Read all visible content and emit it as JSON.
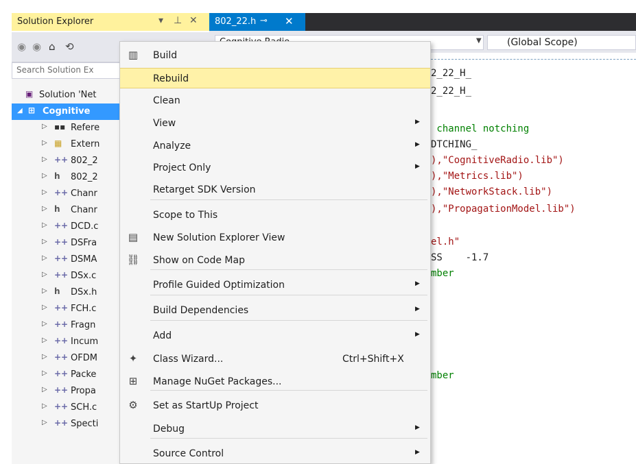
{
  "solution_explorer": {
    "title": "Solution Explorer",
    "controls": {
      "dropdown": "▾",
      "pin": "⊥",
      "close": "✕"
    },
    "search_placeholder": "Search Solution Ex",
    "solution_label": "Solution 'Net",
    "project_label": "Cognitive",
    "items": [
      {
        "label": "Refere",
        "icon": "references-icon",
        "glyph": "▪▪"
      },
      {
        "label": "Extern",
        "icon": "folder-icon",
        "glyph": "▦"
      },
      {
        "label": "802_2",
        "icon": "c-file-icon",
        "glyph": "++"
      },
      {
        "label": "802_2",
        "icon": "h-file-icon",
        "glyph": "h"
      },
      {
        "label": "Chanr",
        "icon": "c-file-icon",
        "glyph": "++"
      },
      {
        "label": "Chanr",
        "icon": "h-file-icon",
        "glyph": "h"
      },
      {
        "label": "DCD.c",
        "icon": "c-file-icon",
        "glyph": "++"
      },
      {
        "label": "DSFra",
        "icon": "c-file-icon",
        "glyph": "++"
      },
      {
        "label": "DSMA",
        "icon": "c-file-icon",
        "glyph": "++"
      },
      {
        "label": "DSx.c",
        "icon": "c-file-icon",
        "glyph": "++"
      },
      {
        "label": "DSx.h",
        "icon": "h-file-icon",
        "glyph": "h"
      },
      {
        "label": "FCH.c",
        "icon": "c-file-icon",
        "glyph": "++"
      },
      {
        "label": "Fragn",
        "icon": "c-file-icon",
        "glyph": "++"
      },
      {
        "label": "Incum",
        "icon": "c-file-icon",
        "glyph": "++"
      },
      {
        "label": "OFDM",
        "icon": "c-file-icon",
        "glyph": "++"
      },
      {
        "label": "Packe",
        "icon": "c-file-icon",
        "glyph": "++"
      },
      {
        "label": "Propa",
        "icon": "c-file-icon",
        "glyph": "++"
      },
      {
        "label": "SCH.c",
        "icon": "c-file-icon",
        "glyph": "++"
      },
      {
        "label": "Specti",
        "icon": "c-file-icon",
        "glyph": "++"
      }
    ]
  },
  "editor": {
    "tab_label": "802_22.h",
    "tab_pin": "⊸",
    "tab_close": "✕",
    "project_dropdown": "Cognitive Radio",
    "scope_dropdown": "(Global Scope)",
    "code_lines": [
      {
        "text": "2_22_H_",
        "kind": "txt"
      },
      {
        "text": "2_22_H_",
        "kind": "txt"
      },
      {
        "text": " channel notching",
        "kind": "cmt"
      },
      {
        "text": "DTCHING_",
        "kind": "txt"
      },
      {
        "text": "),\"CognitiveRadio.lib\")",
        "kind": "str"
      },
      {
        "text": "),\"Metrics.lib\")",
        "kind": "str"
      },
      {
        "text": "),\"NetworkStack.lib\")",
        "kind": "str"
      },
      {
        "text": "),\"PropagationModel.lib\")",
        "kind": "str"
      },
      {
        "text": "el.h\"",
        "kind": "str"
      },
      {
        "text": "SS    -1.7",
        "kind": "txt"
      },
      {
        "text": "mber",
        "kind": "cmt"
      },
      {
        "text": "mber",
        "kind": "cmt"
      }
    ]
  },
  "context_menu": {
    "items": [
      {
        "label": "Build",
        "icon": "build-icon",
        "glyph": "▥"
      },
      {
        "label": "Rebuild",
        "highlighted": true
      },
      {
        "label": "Clean"
      },
      {
        "label": "View",
        "submenu": true
      },
      {
        "label": "Analyze",
        "submenu": true
      },
      {
        "label": "Project Only",
        "submenu": true
      },
      {
        "label": "Retarget SDK Version"
      },
      {
        "label": "Scope to This"
      },
      {
        "label": "New Solution Explorer View",
        "icon": "new-window-icon",
        "glyph": "▤"
      },
      {
        "label": "Show on Code Map",
        "icon": "code-map-icon",
        "glyph": "⛓"
      },
      {
        "label": "Profile Guided Optimization",
        "submenu": true
      },
      {
        "label": "Build Dependencies",
        "submenu": true
      },
      {
        "label": "Add",
        "submenu": true
      },
      {
        "label": "Class Wizard...",
        "shortcut": "Ctrl+Shift+X",
        "icon": "class-wizard-icon",
        "glyph": "✦"
      },
      {
        "label": "Manage NuGet Packages...",
        "icon": "nuget-icon",
        "glyph": "⊞"
      },
      {
        "label": "Set as StartUp Project",
        "icon": "gear-icon",
        "glyph": "⚙"
      },
      {
        "label": "Debug",
        "submenu": true
      },
      {
        "label": "Source Control",
        "submenu": true
      }
    ]
  },
  "colors": {
    "selection": "#3399ff",
    "menu_highlight": "#fff2a8",
    "accent": "#007acc",
    "code_string": "#a31515",
    "code_comment": "#008000"
  }
}
